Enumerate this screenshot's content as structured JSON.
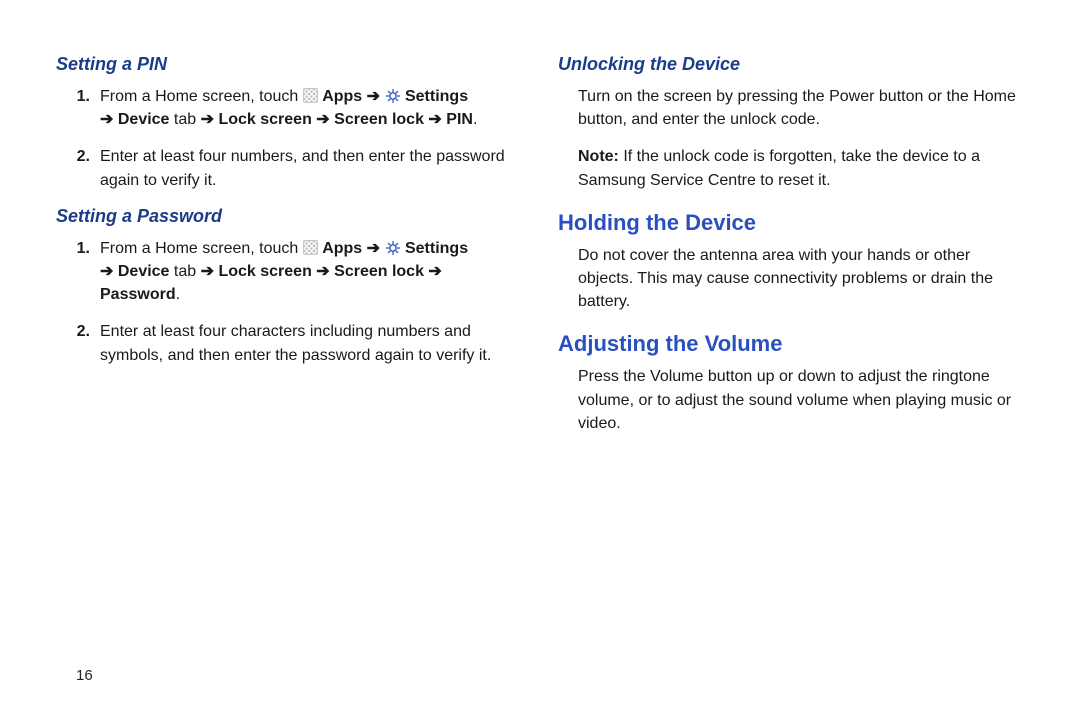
{
  "page_number": "16",
  "arrow_glyph": "➔",
  "left": {
    "section_pin": {
      "heading": "Setting a PIN",
      "steps": [
        {
          "num": "1.",
          "pre": "From a Home screen, touch ",
          "apps_label": " Apps ",
          "settings_label": " Settings ",
          "line2_bold_a": " Device",
          "line2_plain_tab": " tab ",
          "line2_bold_b": " Lock screen ",
          "line2_bold_c": " Screen lock ",
          "line2_bold_d": " PIN",
          "period": "."
        },
        {
          "num": "2.",
          "text": "Enter at least four numbers, and then enter the password again to verify it."
        }
      ]
    },
    "section_password": {
      "heading": "Setting a Password",
      "steps": [
        {
          "num": "1.",
          "pre": "From a Home screen, touch ",
          "apps_label": " Apps ",
          "settings_label": " Settings ",
          "line2_bold_a": " Device",
          "line2_plain_tab": " tab ",
          "line2_bold_b": " Lock screen ",
          "line2_bold_c": " Screen lock ",
          "line2_bold_d": " Password",
          "period": "."
        },
        {
          "num": "2.",
          "text": "Enter at least four characters including numbers and symbols, and then enter the password again to verify it."
        }
      ]
    }
  },
  "right": {
    "section_unlock": {
      "heading": "Unlocking the Device",
      "para": "Turn on the screen by pressing the Power button or the Home button, and enter the unlock code.",
      "note_label": "Note: ",
      "note_body": "If the unlock code is forgotten, take the device to a Samsung Service Centre to reset it."
    },
    "section_holding": {
      "heading": "Holding the Device",
      "para": "Do not cover the antenna area with your hands or other objects. This may cause connectivity problems or drain the battery."
    },
    "section_volume": {
      "heading": "Adjusting the Volume",
      "para": "Press the Volume button up or down to adjust the ringtone volume, or to adjust the sound volume when playing music or video."
    }
  }
}
